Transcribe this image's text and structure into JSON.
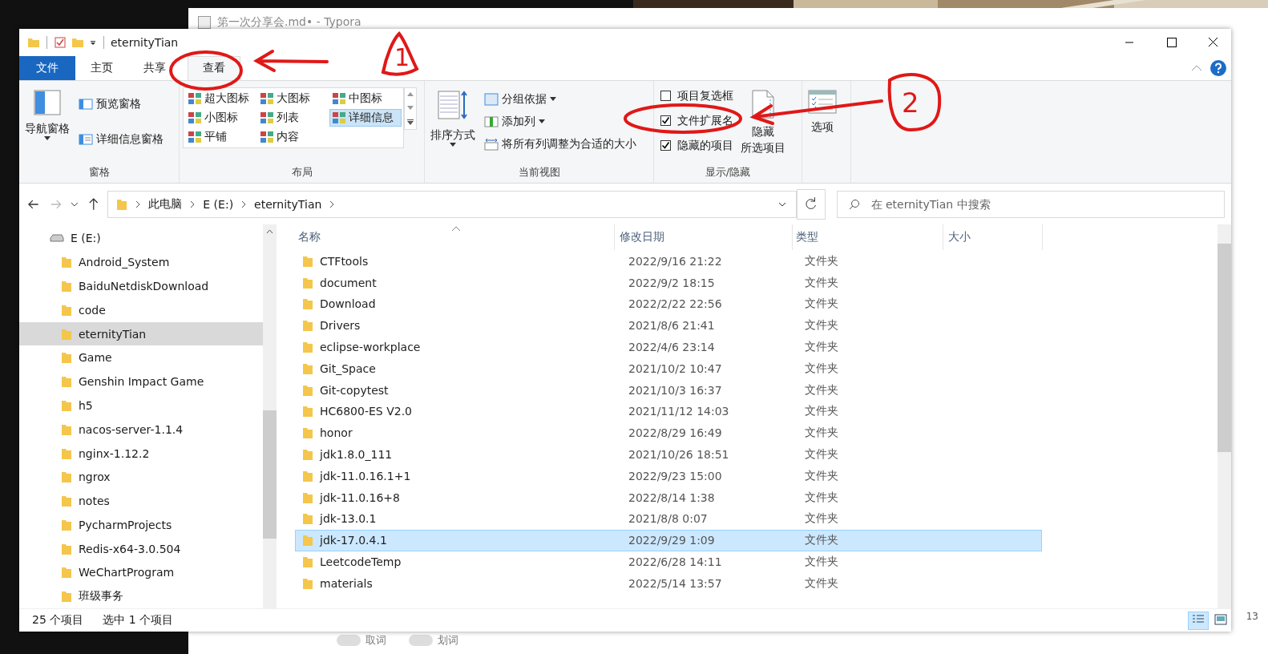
{
  "background": {
    "typora_title": "第一次分享会.md• - Typora",
    "typora_toggles": [
      {
        "label": "取词",
        "on": false
      },
      {
        "label": "划词",
        "on": false
      }
    ],
    "edge_text": "13"
  },
  "window": {
    "title": "eternityTian"
  },
  "tabs": [
    {
      "label": "文件",
      "kind": "file",
      "selected": false
    },
    {
      "label": "主页",
      "kind": "tab",
      "selected": false
    },
    {
      "label": "共享",
      "kind": "tab",
      "selected": false
    },
    {
      "label": "查看",
      "kind": "tab",
      "selected": true
    }
  ],
  "ribbon": {
    "panes": {
      "label": "窗格",
      "navigation": "导航窗格",
      "preview": "预览窗格",
      "details": "详细信息窗格"
    },
    "layout": {
      "label": "布局",
      "options": [
        {
          "label": "超大图标",
          "selected": false
        },
        {
          "label": "大图标",
          "selected": false
        },
        {
          "label": "中图标",
          "selected": false
        },
        {
          "label": "小图标",
          "selected": false
        },
        {
          "label": "列表",
          "selected": false
        },
        {
          "label": "详细信息",
          "selected": true
        },
        {
          "label": "平铺",
          "selected": false
        },
        {
          "label": "内容",
          "selected": false
        }
      ]
    },
    "current_view": {
      "label": "当前视图",
      "sort": "排序方式",
      "group_by": "分组依据",
      "add_column": "添加列",
      "fit_columns": "将所有列调整为合适的大小"
    },
    "show_hide": {
      "label": "显示/隐藏",
      "checkboxes": [
        {
          "label": "项目复选框",
          "checked": false
        },
        {
          "label": "文件扩展名",
          "checked": true
        },
        {
          "label": "隐藏的项目",
          "checked": true
        }
      ],
      "hide_selected": [
        "隐藏",
        "所选项目"
      ]
    },
    "options": "选项"
  },
  "address": {
    "path": [
      "此电脑",
      "E (E:)",
      "eternityTian"
    ],
    "search_placeholder": "在 eternityTian 中搜索"
  },
  "navigation": [
    {
      "label": "E (E:)",
      "kind": "drive",
      "selected": false,
      "children": [
        {
          "label": "Android_System",
          "kind": "folder",
          "selected": false
        },
        {
          "label": "BaiduNetdiskDownload",
          "kind": "folder",
          "selected": false
        },
        {
          "label": "code",
          "kind": "folder",
          "selected": false
        },
        {
          "label": "eternityTian",
          "kind": "folder",
          "selected": true
        },
        {
          "label": "Game",
          "kind": "folder",
          "selected": false
        },
        {
          "label": "Genshin Impact Game",
          "kind": "folder",
          "selected": false
        },
        {
          "label": "h5",
          "kind": "folder",
          "selected": false
        },
        {
          "label": "nacos-server-1.1.4",
          "kind": "folder",
          "selected": false
        },
        {
          "label": "nginx-1.12.2",
          "kind": "folder",
          "selected": false
        },
        {
          "label": "ngrox",
          "kind": "folder",
          "selected": false
        },
        {
          "label": "notes",
          "kind": "folder",
          "selected": false
        },
        {
          "label": "PycharmProjects",
          "kind": "folder",
          "selected": false
        },
        {
          "label": "Redis-x64-3.0.504",
          "kind": "folder",
          "selected": false
        },
        {
          "label": "WeChartProgram",
          "kind": "folder",
          "selected": false
        },
        {
          "label": "班级事务",
          "kind": "folder",
          "selected": false
        }
      ]
    }
  ],
  "table": {
    "columns": [
      "名称",
      "修改日期",
      "类型",
      "大小"
    ],
    "rows": [
      {
        "name": "CTFtools",
        "modified": "2022/9/16 21:22",
        "type": "文件夹",
        "selected": false
      },
      {
        "name": "document",
        "modified": "2022/9/2 18:15",
        "type": "文件夹",
        "selected": false
      },
      {
        "name": "Download",
        "modified": "2022/2/22 22:56",
        "type": "文件夹",
        "selected": false
      },
      {
        "name": "Drivers",
        "modified": "2021/8/6 21:41",
        "type": "文件夹",
        "selected": false
      },
      {
        "name": "eclipse-workplace",
        "modified": "2022/4/6 23:14",
        "type": "文件夹",
        "selected": false
      },
      {
        "name": "Git_Space",
        "modified": "2021/10/2 10:47",
        "type": "文件夹",
        "selected": false
      },
      {
        "name": "Git-copytest",
        "modified": "2021/10/3 16:37",
        "type": "文件夹",
        "selected": false
      },
      {
        "name": "HC6800-ES V2.0",
        "modified": "2021/11/12 14:03",
        "type": "文件夹",
        "selected": false
      },
      {
        "name": "honor",
        "modified": "2022/8/29 16:49",
        "type": "文件夹",
        "selected": false
      },
      {
        "name": "jdk1.8.0_111",
        "modified": "2021/10/26 18:51",
        "type": "文件夹",
        "selected": false
      },
      {
        "name": "jdk-11.0.16.1+1",
        "modified": "2022/9/23 15:00",
        "type": "文件夹",
        "selected": false
      },
      {
        "name": "jdk-11.0.16+8",
        "modified": "2022/8/14 1:38",
        "type": "文件夹",
        "selected": false
      },
      {
        "name": "jdk-13.0.1",
        "modified": "2021/8/8 0:07",
        "type": "文件夹",
        "selected": false
      },
      {
        "name": "jdk-17.0.4.1",
        "modified": "2022/9/29 1:09",
        "type": "文件夹",
        "selected": true
      },
      {
        "name": "LeetcodeTemp",
        "modified": "2022/6/28 14:11",
        "type": "文件夹",
        "selected": false
      },
      {
        "name": "materials",
        "modified": "2022/5/14 13:57",
        "type": "文件夹",
        "selected": false
      }
    ]
  },
  "status_bar": {
    "item_count": "25 个项目",
    "selection": "选中 1 个项目",
    "views": [
      {
        "kind": "details",
        "selected": true
      },
      {
        "kind": "large",
        "selected": false
      }
    ]
  },
  "annotations": [
    {
      "label": "1"
    },
    {
      "label": "2"
    }
  ]
}
